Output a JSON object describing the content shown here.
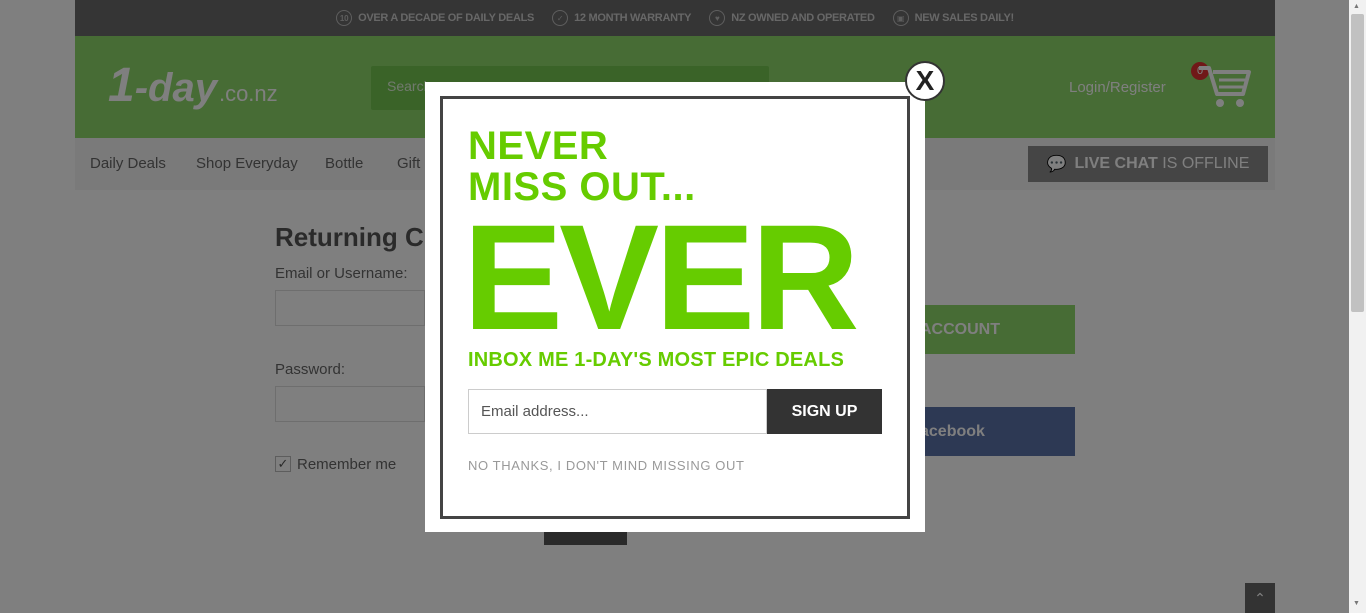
{
  "topbar": {
    "items": [
      {
        "icon": "10",
        "label": "OVER A DECADE OF DAILY DEALS"
      },
      {
        "icon": "✓",
        "label": "12 MONTH WARRANTY"
      },
      {
        "icon": "♥",
        "label": "NZ OWNED AND OPERATED"
      },
      {
        "icon": "▣",
        "label": "NEW SALES DAILY!"
      }
    ]
  },
  "header": {
    "logo_one": "1",
    "logo_day": "-day",
    "logo_tld": ".co.nz",
    "search_placeholder": "Search",
    "login_label": "Login/Register",
    "cart_count": "0"
  },
  "nav": {
    "items": [
      "Daily Deals",
      "Shop Everyday",
      "Bottle",
      "Gift"
    ],
    "livechat_bold": "LIVE CHAT",
    "livechat_rest": "IS OFFLINE"
  },
  "login": {
    "title": "Returning Cu",
    "email_label": "Email or Username:",
    "password_label": "Password:",
    "remember_label": "Remember me",
    "create_account_label": "ACCOUNT",
    "facebook_label": "acebook"
  },
  "modal": {
    "heading_line1": "NEVER",
    "heading_line2": "MISS OUT...",
    "big_word": "EVER",
    "subheading": "INBOX ME 1-DAY'S MOST EPIC DEALS",
    "email_placeholder": "Email address...",
    "signup_label": "SIGN UP",
    "no_thanks": "NO THANKS, I DON'T MIND MISSING OUT",
    "close_label": "X"
  },
  "colors": {
    "brand_green": "#66cc00",
    "header_green": "#8ed96a",
    "dark": "#333333"
  }
}
